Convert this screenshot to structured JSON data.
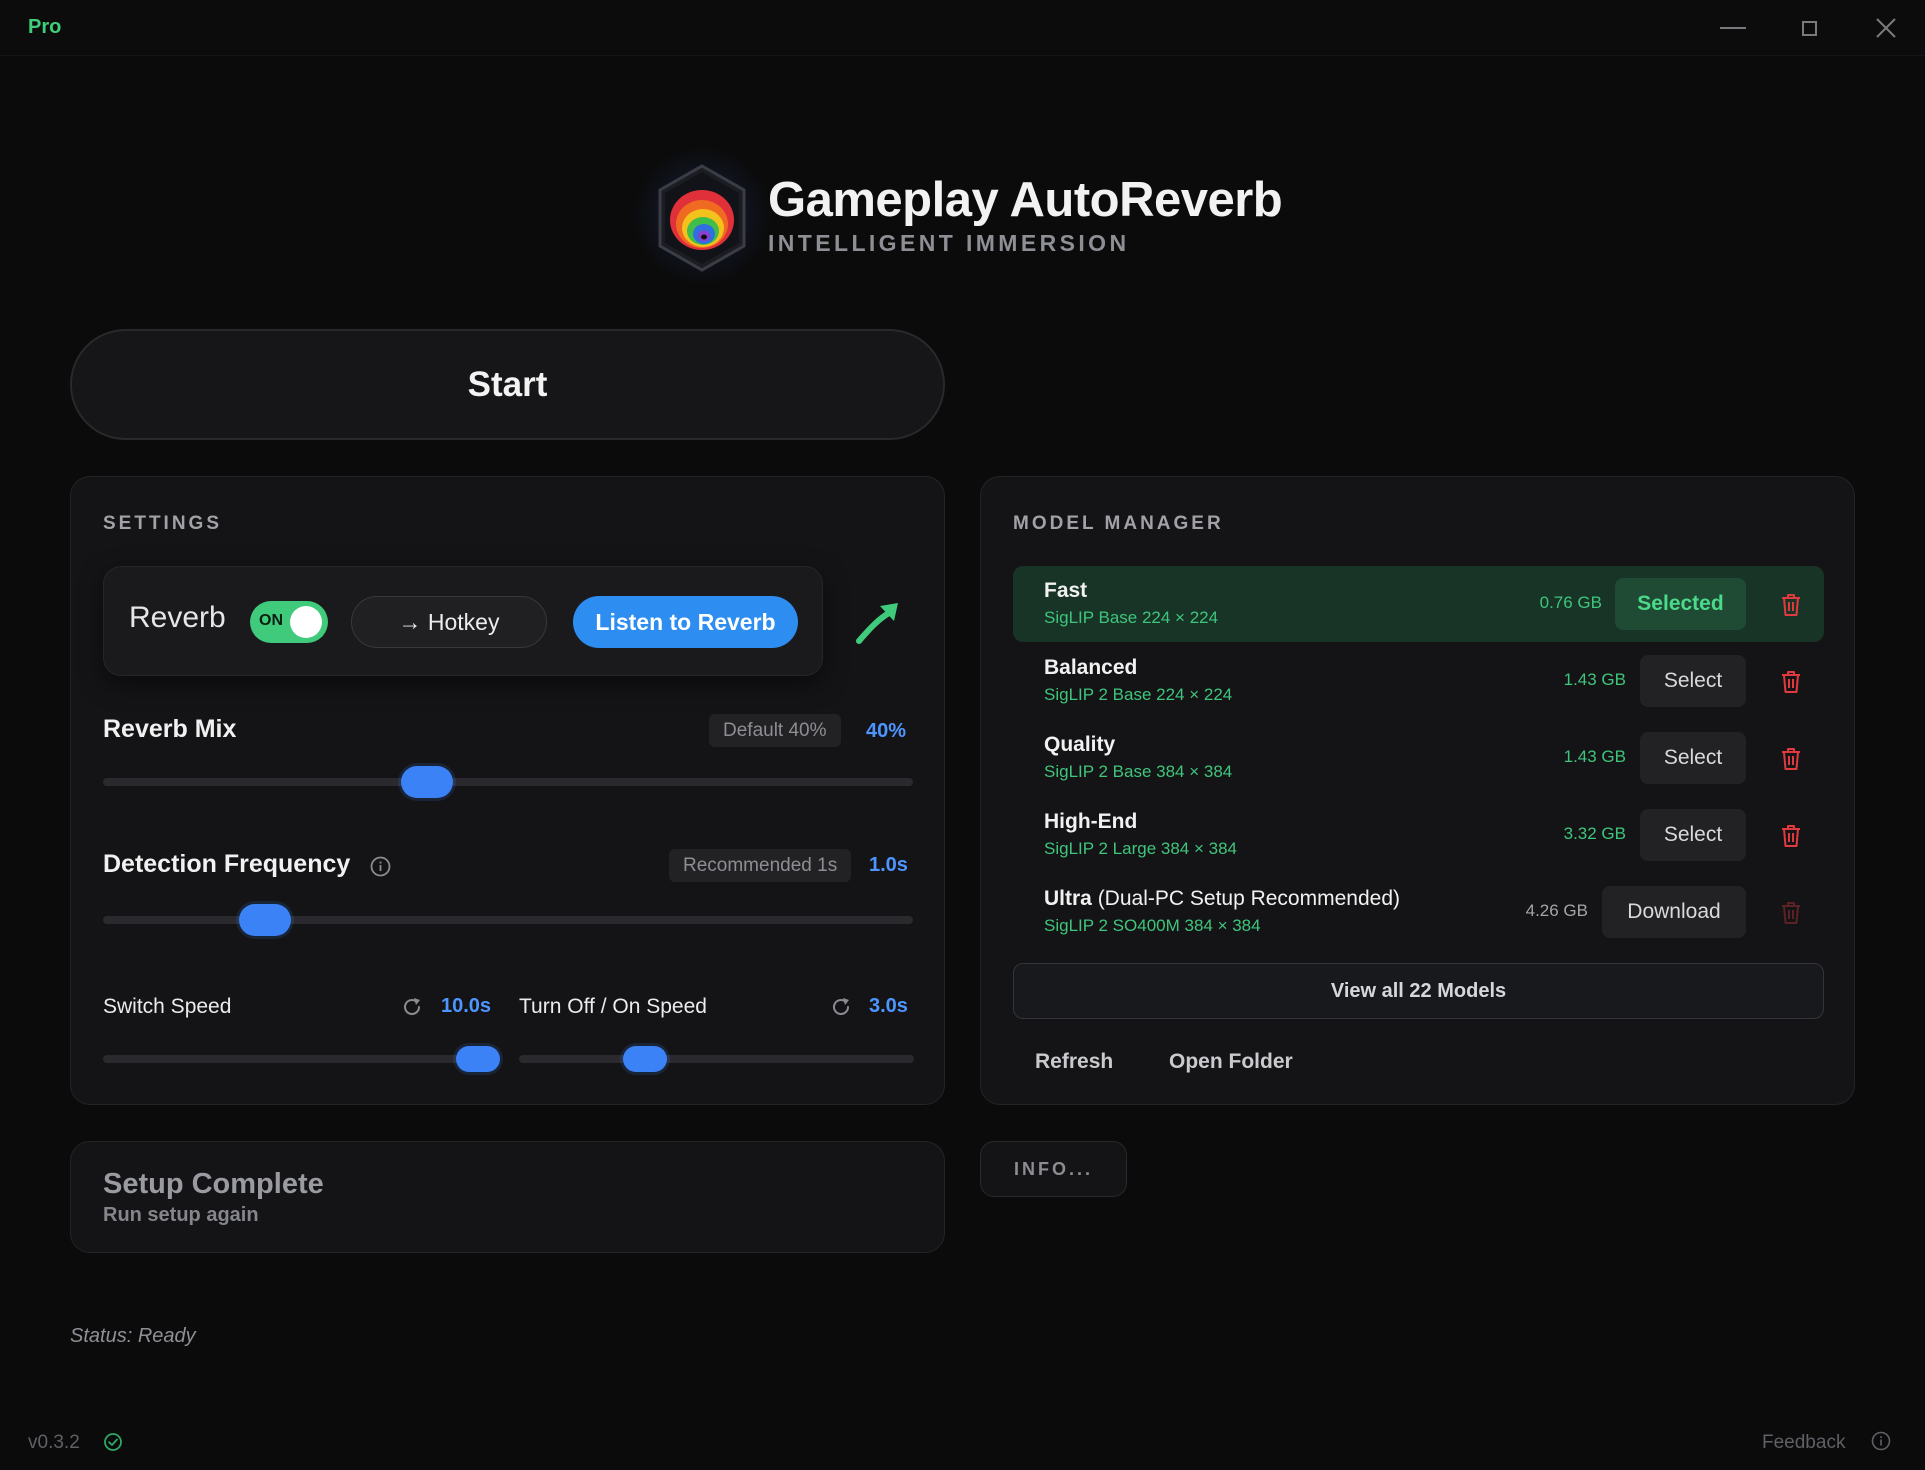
{
  "titlebar": {
    "badge": "Pro",
    "controls": {
      "minimize": "minimize-icon",
      "maximize": "maximize-icon",
      "close": "close-icon"
    }
  },
  "header": {
    "title": "Gameplay AutoReverb",
    "subtitle": "INTELLIGENT IMMERSION"
  },
  "start_label": "Start",
  "settings": {
    "section_title": "SETTINGS",
    "reverb": {
      "label": "Reverb",
      "toggle_state": "ON",
      "hotkey_label": "→ Hotkey",
      "listen_label": "Listen to Reverb"
    },
    "reverb_mix": {
      "label": "Reverb Mix",
      "default_label": "Default 40%",
      "value": "40%",
      "fraction": 0.4
    },
    "detection_frequency": {
      "label": "Detection Frequency",
      "recommended_label": "Recommended 1s",
      "value": "1.0s",
      "fraction": 0.2
    },
    "switch_speed": {
      "label": "Switch Speed",
      "value": "10.0s",
      "fraction": 0.95
    },
    "turn_off_on_speed": {
      "label": "Turn Off / On Speed",
      "value": "3.0s",
      "fraction": 0.32
    }
  },
  "models": {
    "section_title": "MODEL MANAGER",
    "items": [
      {
        "name": "Fast",
        "extra": "",
        "spec": "SigLIP Base 224 × 224",
        "size": "0.76 GB",
        "action": "Selected"
      },
      {
        "name": "Balanced",
        "extra": "",
        "spec": "SigLIP 2 Base 224 × 224",
        "size": "1.43 GB",
        "action": "Select"
      },
      {
        "name": "Quality",
        "extra": "",
        "spec": "SigLIP 2 Base 384 × 384",
        "size": "1.43 GB",
        "action": "Select"
      },
      {
        "name": "High-End",
        "extra": "",
        "spec": "SigLIP 2 Large 384 × 384",
        "size": "3.32 GB",
        "action": "Select"
      },
      {
        "name": "Ultra",
        "extra": " (Dual-PC Setup Recommended)",
        "spec": "SigLIP 2 SO400M 384 × 384",
        "size": "4.26 GB",
        "action": "Download"
      }
    ],
    "view_all_label": "View all 22 Models",
    "refresh_label": "Refresh",
    "open_folder_label": "Open Folder"
  },
  "setup": {
    "title": "Setup Complete",
    "subtitle": "Run setup again"
  },
  "info_label": "INFO...",
  "status": "Status: Ready",
  "footer": {
    "version": "v0.3.2",
    "feedback": "Feedback"
  },
  "colors": {
    "accent_blue": "#3b82f6",
    "accent_green": "#3fcb7b",
    "danger_red": "#e0393e",
    "background": "#0b0b0c"
  }
}
